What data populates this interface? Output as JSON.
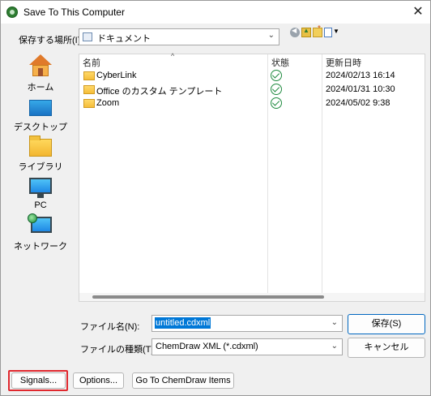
{
  "window": {
    "title": "Save To This Computer",
    "close_glyph": "✕"
  },
  "location": {
    "label": "保存する場所(I):",
    "value": "ドキュメント",
    "chevron": "⌄"
  },
  "places": [
    {
      "label": "ホーム",
      "icon": "home-icon"
    },
    {
      "label": "デスクトップ",
      "icon": "desktop-icon"
    },
    {
      "label": "ライブラリ",
      "icon": "library-icon"
    },
    {
      "label": "PC",
      "icon": "pc-icon"
    },
    {
      "label": "ネットワーク",
      "icon": "network-icon"
    }
  ],
  "filelist": {
    "columns": {
      "name": "名前",
      "status": "状態",
      "date": "更新日時"
    },
    "sort_indicator": "^",
    "rows": [
      {
        "name": "CyberLink",
        "date": "2024/02/13 16:14",
        "status": "synced"
      },
      {
        "name": "Office のカスタム テンプレート",
        "date": "2024/01/31 10:30",
        "status": "synced"
      },
      {
        "name": "Zoom",
        "date": "2024/05/02 9:38",
        "status": "synced"
      }
    ]
  },
  "filename": {
    "label": "ファイル名(N):",
    "value": "untitled.cdxml",
    "chevron": "⌄"
  },
  "filetype": {
    "label": "ファイルの種類(T):",
    "value": "ChemDraw XML (*.cdxml)",
    "chevron": "⌄"
  },
  "buttons": {
    "save": "保存(S)",
    "cancel": "キャンセル",
    "signals": "Signals...",
    "options": "Options...",
    "chemdraw": "Go To ChemDraw Items"
  },
  "colors": {
    "accent": "#0078d7",
    "highlight": "#e0282e",
    "status_ok": "#1f8a3f"
  }
}
